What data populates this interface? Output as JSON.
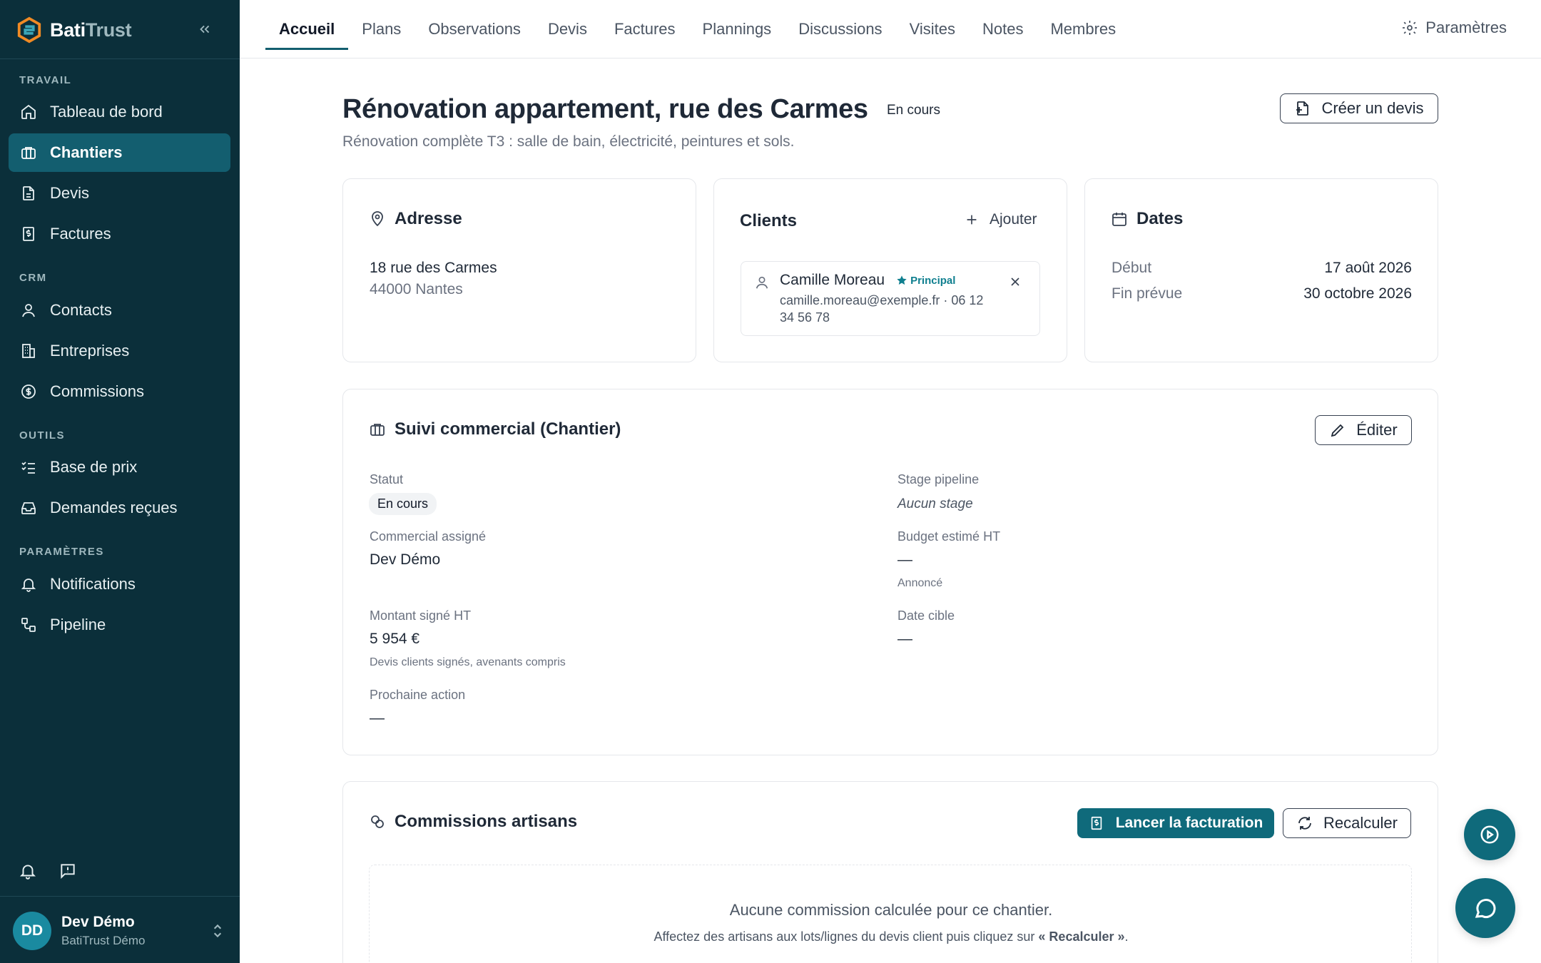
{
  "brand": {
    "name_part1": "Bati",
    "name_part2": "Trust"
  },
  "sidebar": {
    "sections": {
      "travail": "TRAVAIL",
      "crm": "CRM",
      "outils": "OUTILS",
      "parametres": "PARAMÈTRES"
    },
    "items": [
      {
        "label": "Tableau de bord",
        "icon": "home-icon"
      },
      {
        "label": "Chantiers",
        "icon": "briefcase-icon",
        "active": true
      },
      {
        "label": "Devis",
        "icon": "file-icon"
      },
      {
        "label": "Factures",
        "icon": "invoice-icon"
      },
      {
        "label": "Contacts",
        "icon": "user-icon"
      },
      {
        "label": "Entreprises",
        "icon": "building-icon"
      },
      {
        "label": "Commissions",
        "icon": "dollar-circle-icon"
      },
      {
        "label": "Base de prix",
        "icon": "list-check-icon"
      },
      {
        "label": "Demandes reçues",
        "icon": "inbox-icon"
      },
      {
        "label": "Notifications",
        "icon": "bell-icon"
      },
      {
        "label": "Pipeline",
        "icon": "workflow-icon"
      }
    ],
    "user": {
      "initials": "DD",
      "name": "Dev Démo",
      "org": "BatiTrust Démo"
    }
  },
  "tabs": [
    "Accueil",
    "Plans",
    "Observations",
    "Devis",
    "Factures",
    "Plannings",
    "Discussions",
    "Visites",
    "Notes",
    "Membres"
  ],
  "settings_label": "Paramètres",
  "project": {
    "title": "Rénovation appartement, rue des Carmes",
    "status": "En cours",
    "subtitle": "Rénovation complète T3 : salle de bain, électricité, peintures et sols.",
    "create_quote": "Créer un devis"
  },
  "address": {
    "title": "Adresse",
    "line1": "18 rue des Carmes",
    "line2": "44000 Nantes"
  },
  "clients": {
    "title": "Clients",
    "add_label": "Ajouter",
    "client": {
      "name": "Camille Moreau",
      "badge": "Principal",
      "contact_line1": "camille.moreau@exemple.fr · 06 12",
      "contact_line2": "34 56 78"
    }
  },
  "dates": {
    "title": "Dates",
    "start_label": "Début",
    "start_value": "17 août 2026",
    "end_label": "Fin prévue",
    "end_value": "30 octobre 2026"
  },
  "commercial": {
    "title": "Suivi commercial (Chantier)",
    "edit_label": "Éditer",
    "statut_label": "Statut",
    "statut_value": "En cours",
    "stage_label": "Stage pipeline",
    "stage_value": "Aucun stage",
    "assigned_label": "Commercial assigné",
    "assigned_value": "Dev Démo",
    "budget_label": "Budget estimé HT",
    "budget_value": "—",
    "budget_hint": "Annoncé",
    "signed_label": "Montant signé HT",
    "signed_value": "5 954 €",
    "signed_hint": "Devis clients signés, avenants compris",
    "target_label": "Date cible",
    "target_value": "—",
    "next_label": "Prochaine action",
    "next_value": "—"
  },
  "commissions": {
    "title": "Commissions artisans",
    "primary_button": "Lancer la facturation",
    "recalc_button": "Recalculer",
    "empty_title": "Aucune commission calculée pour ce chantier.",
    "empty_desc_prefix": "Affectez des artisans aux lots/lignes du devis client puis cliquez sur ",
    "empty_desc_strong": "« Recalculer »",
    "empty_desc_suffix": "."
  }
}
